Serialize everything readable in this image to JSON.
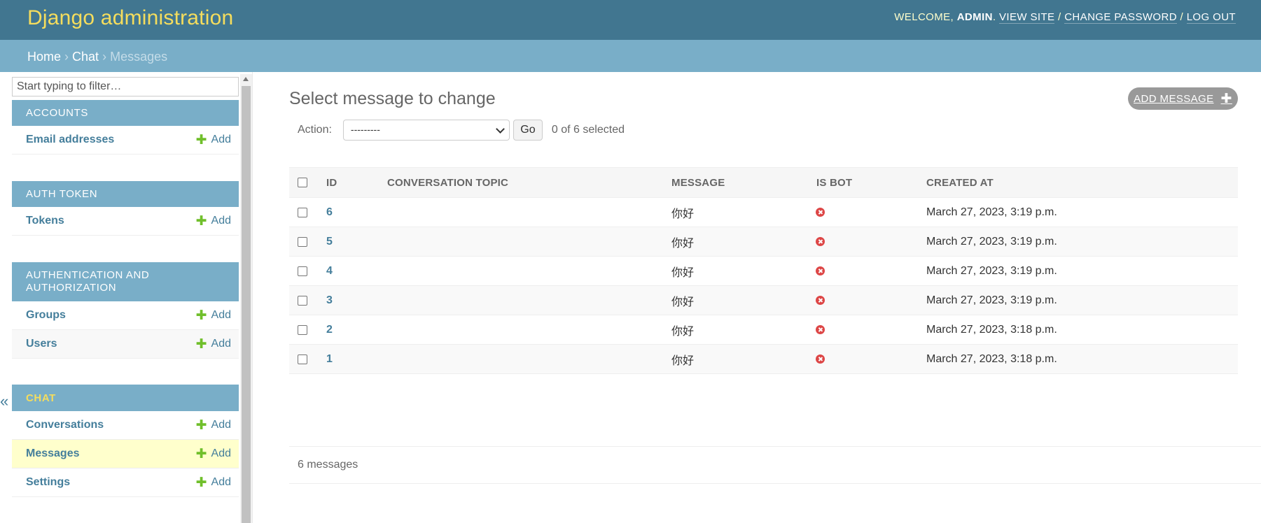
{
  "header": {
    "title": "Django administration",
    "welcome": "Welcome,",
    "username": "admin",
    "view_site": "View site",
    "change_password": "Change password",
    "log_out": "Log out"
  },
  "breadcrumbs": {
    "home": "Home",
    "app": "Chat",
    "current": "Messages"
  },
  "sidebar": {
    "filter_placeholder": "Start typing to filter…",
    "toggle": "«",
    "add_label": "Add",
    "apps": [
      {
        "caption": "Accounts",
        "models": [
          {
            "name": "Email addresses"
          }
        ]
      },
      {
        "caption": "Auth Token",
        "models": [
          {
            "name": "Tokens"
          }
        ]
      },
      {
        "caption": "Authentication and Authorization",
        "models": [
          {
            "name": "Groups"
          },
          {
            "name": "Users"
          }
        ]
      },
      {
        "caption": "Chat",
        "models": [
          {
            "name": "Conversations"
          },
          {
            "name": "Messages",
            "current": true
          },
          {
            "name": "Settings"
          }
        ]
      }
    ]
  },
  "main": {
    "title": "Select message to change",
    "add_button": "Add message",
    "action_label": "Action:",
    "action_selected": "---------",
    "go_label": "Go",
    "selection_count": "0 of 6 selected",
    "columns": [
      "ID",
      "Conversation topic",
      "Message",
      "Is bot",
      "Created at"
    ],
    "rows": [
      {
        "id": "6",
        "topic": "",
        "message": "你好",
        "is_bot": false,
        "created": "March 27, 2023, 3:19 p.m."
      },
      {
        "id": "5",
        "topic": "",
        "message": "你好",
        "is_bot": false,
        "created": "March 27, 2023, 3:19 p.m."
      },
      {
        "id": "4",
        "topic": "",
        "message": "你好",
        "is_bot": false,
        "created": "March 27, 2023, 3:19 p.m."
      },
      {
        "id": "3",
        "topic": "",
        "message": "你好",
        "is_bot": false,
        "created": "March 27, 2023, 3:19 p.m."
      },
      {
        "id": "2",
        "topic": "",
        "message": "你好",
        "is_bot": false,
        "created": "March 27, 2023, 3:18 p.m."
      },
      {
        "id": "1",
        "topic": "",
        "message": "你好",
        "is_bot": false,
        "created": "March 27, 2023, 3:18 p.m."
      }
    ],
    "paginator": "6 messages"
  },
  "colors": {
    "header_bg": "#417690",
    "brand": "#f5dd5d",
    "breadcrumbs_bg": "#79aec8",
    "link": "#447e9b",
    "add_green": "#70bf2b",
    "current_row": "#ffffcc",
    "no_icon": "#dd4646"
  }
}
